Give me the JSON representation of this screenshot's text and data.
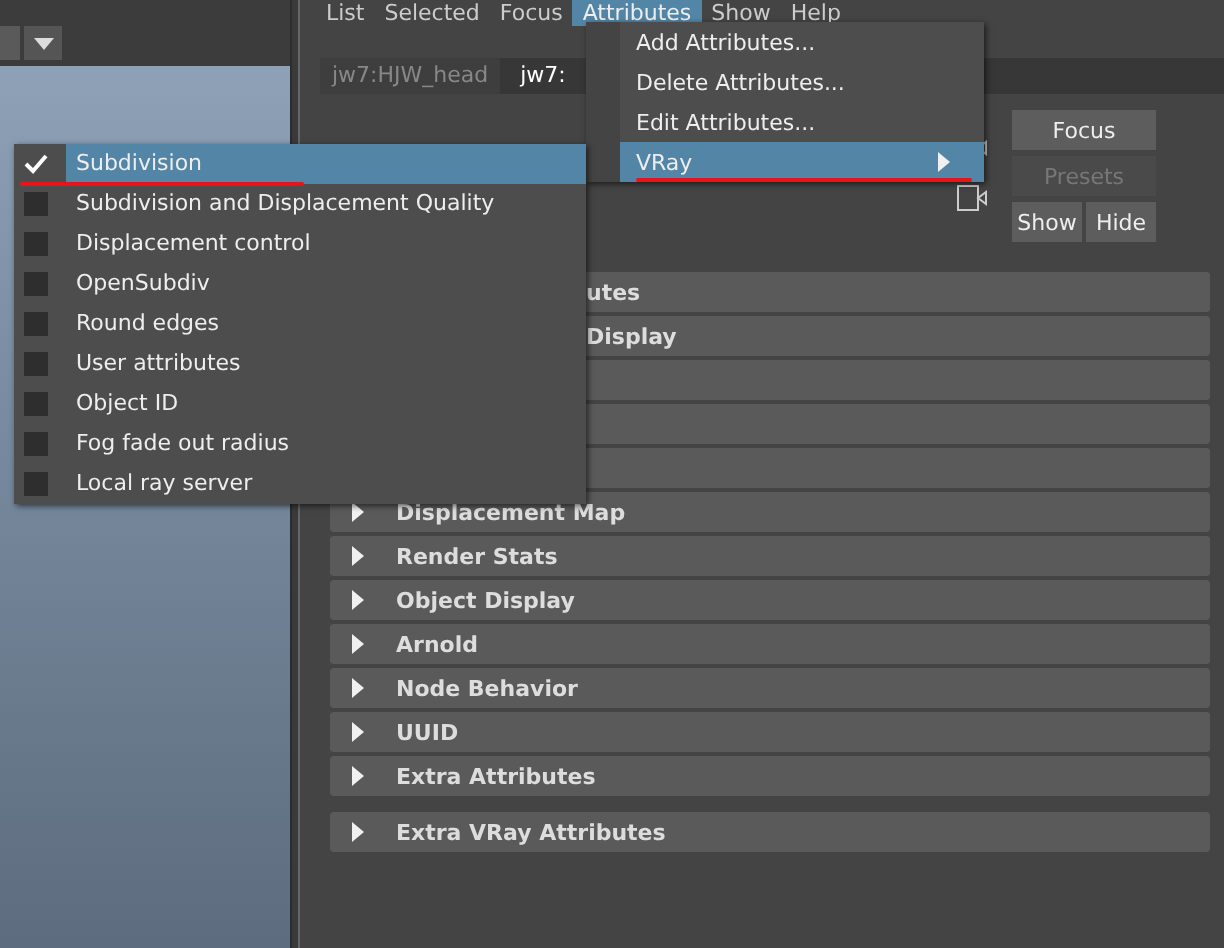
{
  "menu_bar": [
    {
      "label": "List",
      "selected": false
    },
    {
      "label": "Selected",
      "selected": false
    },
    {
      "label": "Focus",
      "selected": false
    },
    {
      "label": "Attributes",
      "selected": true
    },
    {
      "label": "Show",
      "selected": false
    },
    {
      "label": "Help",
      "selected": false
    }
  ],
  "tabs": [
    {
      "label": "jw7:HJW_head",
      "selected": false
    },
    {
      "label": "jw7:",
      "selected": true
    }
  ],
  "buttons": [
    {
      "label": "Focus",
      "disabled": false
    },
    {
      "label": "Presets",
      "disabled": true
    },
    {
      "label": "Show",
      "disabled": false
    },
    {
      "label": "Hide",
      "disabled": false
    }
  ],
  "sections": [
    {
      "kind": "covered",
      "label": "utes"
    },
    {
      "kind": "covered",
      "label": "Display"
    },
    {
      "kind": "blank"
    },
    {
      "kind": "blank"
    },
    {
      "kind": "blank"
    },
    {
      "kind": "header",
      "label": "Displacement Map",
      "expanded": false
    },
    {
      "kind": "header",
      "label": "Render Stats",
      "expanded": false
    },
    {
      "kind": "header",
      "label": "Object Display",
      "expanded": false
    },
    {
      "kind": "header",
      "label": "Arnold",
      "expanded": false
    },
    {
      "kind": "header",
      "label": "Node Behavior",
      "expanded": false
    },
    {
      "kind": "header",
      "label": "UUID",
      "expanded": false
    },
    {
      "kind": "header",
      "label": "Extra Attributes",
      "expanded": false
    }
  ],
  "extra_sections": [
    {
      "kind": "header",
      "label": "Extra VRay Attributes",
      "expanded": false
    }
  ],
  "attributes_menu": [
    {
      "label": "Add Attributes...",
      "selected": false,
      "submenu": false,
      "underlined": false
    },
    {
      "label": "Delete Attributes...",
      "selected": false,
      "submenu": false,
      "underlined": false
    },
    {
      "label": "Edit Attributes...",
      "selected": false,
      "submenu": false,
      "underlined": false
    },
    {
      "label": "VRay",
      "selected": true,
      "submenu": true,
      "underlined": true
    }
  ],
  "vray_menu": [
    {
      "label": "Subdivision",
      "checked": true,
      "selected": true,
      "underlined": true
    },
    {
      "label": "Subdivision and Displacement Quality",
      "checked": false,
      "selected": false,
      "underlined": false
    },
    {
      "label": "Displacement control",
      "checked": false,
      "selected": false,
      "underlined": false
    },
    {
      "label": "OpenSubdiv",
      "checked": false,
      "selected": false,
      "underlined": false
    },
    {
      "label": "Round edges",
      "checked": false,
      "selected": false,
      "underlined": false
    },
    {
      "label": "User attributes",
      "checked": false,
      "selected": false,
      "underlined": false
    },
    {
      "label": "Object ID",
      "checked": false,
      "selected": false,
      "underlined": false
    },
    {
      "label": "Fog fade out radius",
      "checked": false,
      "selected": false,
      "underlined": false
    },
    {
      "label": "Local ray server",
      "checked": false,
      "selected": false,
      "underlined": false
    }
  ]
}
